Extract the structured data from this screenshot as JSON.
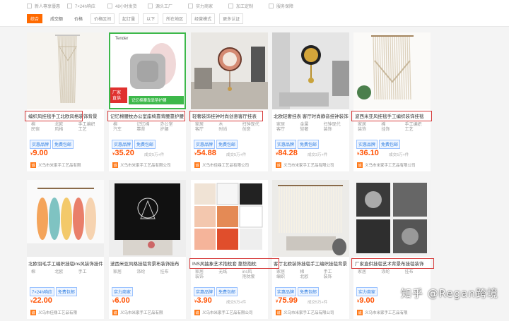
{
  "filters": {
    "checkboxes": [
      "新人專享優惠",
      "7×24h响应",
      "48小时发货",
      "源头工厂",
      "实力商家",
      "加工定制",
      "服务保障"
    ],
    "tabs": [
      "综合",
      "成交额",
      "价格",
      "价格区间",
      "起订量",
      "以下",
      "所在地区",
      "经营模式",
      "更多认证"
    ],
    "selected_tab": "综合"
  },
  "products": [
    {
      "title": "编织风挂毯手工北欧风格装饰背景",
      "attrs": [
        "棉",
        "北欧",
        "手工编织",
        "民宿",
        "风格",
        "工艺"
      ],
      "tags": [
        "实惠品牌",
        "免费包邮"
      ],
      "price": "9.00",
      "sub": "",
      "shop": "义乌市米家手工艺品有限"
    },
    {
      "title": "记忆棉腰枕办公室座椅靠背腰靠护腰",
      "attrs": [
        "棉",
        "记忆棉",
        "办公室",
        "汽车",
        "靠背",
        "护腰"
      ],
      "tags": [
        "实惠品牌",
        "免费包邮"
      ],
      "price": "35.20",
      "sub": "成交5万+件",
      "shop": "义乌市米家手工艺品有限公司",
      "badge": "厂家直供"
    },
    {
      "title": "轻奢装饰挂钟时尚创意客厅挂表",
      "attrs": [
        "家居",
        "木",
        "扫钟现代",
        "客厅",
        "时尚",
        "创意"
      ],
      "tags": [
        "实惠品牌",
        "免费包邮"
      ],
      "price": "54.88",
      "sub": "成交5万+件",
      "shop": "义乌市佳鼎工艺品有限公司"
    },
    {
      "title": "北欧轻奢挂表 客厅时尚静音挂钟装饰",
      "attrs": [
        "家居",
        "金属",
        "扫钟现代",
        "客厅",
        "轻奢",
        "装饰"
      ],
      "tags": [
        "实惠品牌",
        "免费包邮"
      ],
      "price": "84.28",
      "sub": "成交3万+件",
      "shop": "义乌市米家手工艺品有限公司"
    },
    {
      "title": "波西米亚风挂毯手工编织装饰挂毯",
      "attrs": [
        "家居",
        "棉",
        "手工编织",
        "装饰",
        "挂饰",
        "工艺"
      ],
      "tags": [
        "实惠品牌",
        "免费包邮"
      ],
      "price": "36.10",
      "sub": "成交5万+件",
      "shop": "义乌市米家手工艺品有限公司"
    },
    {
      "title": "北欧羽毛手工编织挂毯ins风装饰挂件",
      "attrs": [
        "棉",
        "北欧",
        "手工",
        "",
        "",
        ""
      ],
      "tags": [
        "7×24h响应",
        "免费包邮"
      ],
      "price": "22.00",
      "sub": "",
      "shop": "义乌市佳鼎工艺品有限"
    },
    {
      "title": "波西米亚风格挂毯背景布装饰挂布",
      "attrs": [
        "家居",
        "涤纶",
        "挂布",
        "",
        "",
        ""
      ],
      "tags": [
        "实力商家"
      ],
      "price": "6.00",
      "sub": "",
      "shop": "义乌市米家手工艺品有限"
    },
    {
      "title": "INS风抽象艺术抱枕套 靠垫抱枕",
      "attrs": [
        "家居",
        "无纸",
        "ins风",
        "装饰",
        "",
        "抱枕套"
      ],
      "tags": [
        "实惠品牌",
        "免费包邮"
      ],
      "price": "3.90",
      "sub": "成交5万+件",
      "shop": "义乌市米家手工艺品有限公司"
    },
    {
      "title": "客厅北欧装饰挂毯手工编织挂毯背景",
      "attrs": [
        "家居",
        "棉",
        "手工",
        "编织",
        "北欧",
        "装饰"
      ],
      "tags": [
        "实惠品牌",
        "免费包邮"
      ],
      "price": "75.99",
      "sub": "成交5万+件",
      "shop": "义乌市米家手工艺品有限公司"
    },
    {
      "title": "厂家直供挂毯艺术背景布挂毯装饰",
      "attrs": [
        "家居",
        "涤纶",
        "挂布",
        "",
        "",
        ""
      ],
      "tags": [
        "实力商家"
      ],
      "price": "9.00",
      "sub": "",
      "shop": "义乌市米家手工艺品有限"
    }
  ],
  "watermark": "知乎 @Regan跨境"
}
